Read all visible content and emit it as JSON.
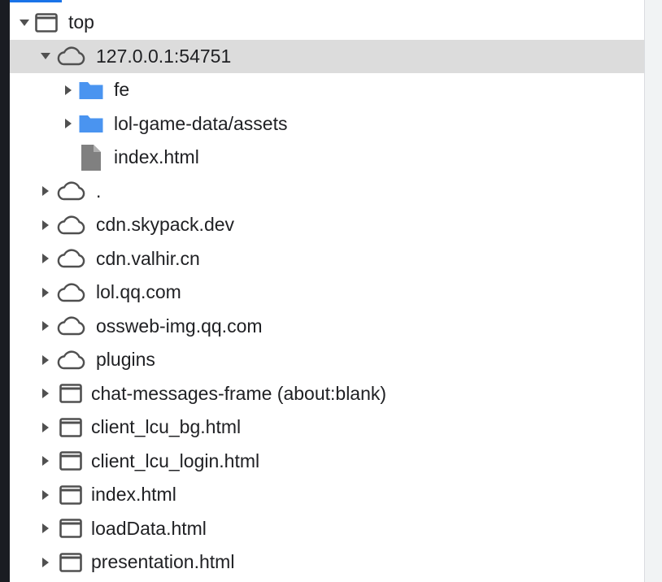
{
  "tree": {
    "root": {
      "label": "top",
      "icon": "frame-icon",
      "expanded": true
    },
    "origin": {
      "label": "127.0.0.1:54751",
      "icon": "cloud-icon",
      "expanded": true,
      "selected": true
    },
    "origin_children": [
      {
        "label": "fe",
        "icon": "folder-icon",
        "expandable": true
      },
      {
        "label": "lol-game-data/assets",
        "icon": "folder-icon",
        "expandable": true
      },
      {
        "label": "index.html",
        "icon": "file-icon",
        "expandable": false
      }
    ],
    "items": [
      {
        "label": ".",
        "icon": "cloud-icon"
      },
      {
        "label": "cdn.skypack.dev",
        "icon": "cloud-icon"
      },
      {
        "label": "cdn.valhir.cn",
        "icon": "cloud-icon"
      },
      {
        "label": "lol.qq.com",
        "icon": "cloud-icon"
      },
      {
        "label": "ossweb-img.qq.com",
        "icon": "cloud-icon"
      },
      {
        "label": "plugins",
        "icon": "cloud-icon"
      },
      {
        "label": "chat-messages-frame (about:blank)",
        "icon": "frame-icon"
      },
      {
        "label": "client_lcu_bg.html",
        "icon": "frame-icon"
      },
      {
        "label": "client_lcu_login.html",
        "icon": "frame-icon"
      },
      {
        "label": "index.html",
        "icon": "frame-icon"
      },
      {
        "label": "loadData.html",
        "icon": "frame-icon"
      },
      {
        "label": "presentation.html",
        "icon": "frame-icon"
      }
    ]
  },
  "colors": {
    "selected_row": "#dcdcdc",
    "folder": "#4a94f0",
    "file": "#808080",
    "icon_stroke": "#505050",
    "accent": "#1a73e8"
  }
}
